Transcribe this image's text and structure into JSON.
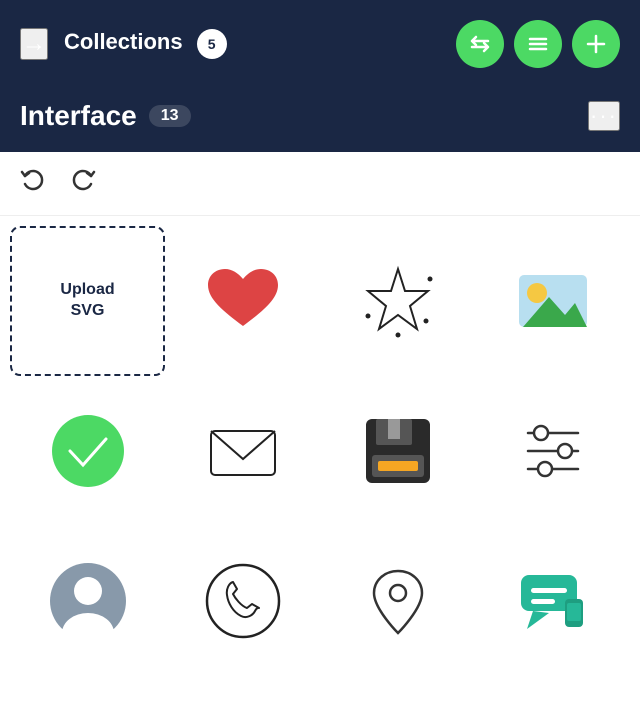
{
  "header": {
    "title": "Collections",
    "count": "5",
    "back_arrow": "→",
    "btn_swap": "⇔",
    "btn_list": "≡",
    "btn_add": "+"
  },
  "subheader": {
    "title": "Interface",
    "count": "13",
    "more": "···"
  },
  "toolbar": {
    "undo": "↩",
    "redo": "↪"
  },
  "upload_cell": {
    "label": "Upload\nSVG"
  },
  "icons": [
    {
      "name": "heart",
      "row": 0,
      "col": 1
    },
    {
      "name": "star",
      "row": 0,
      "col": 2
    },
    {
      "name": "image",
      "row": 0,
      "col": 3
    },
    {
      "name": "checkmark",
      "row": 1,
      "col": 0
    },
    {
      "name": "mail",
      "row": 1,
      "col": 1
    },
    {
      "name": "floppy-disk",
      "row": 1,
      "col": 2
    },
    {
      "name": "sliders",
      "row": 1,
      "col": 3
    },
    {
      "name": "avatar",
      "row": 2,
      "col": 0
    },
    {
      "name": "phone",
      "row": 2,
      "col": 1
    },
    {
      "name": "location-pin",
      "row": 2,
      "col": 2
    },
    {
      "name": "chat-bubble",
      "row": 2,
      "col": 3
    }
  ]
}
